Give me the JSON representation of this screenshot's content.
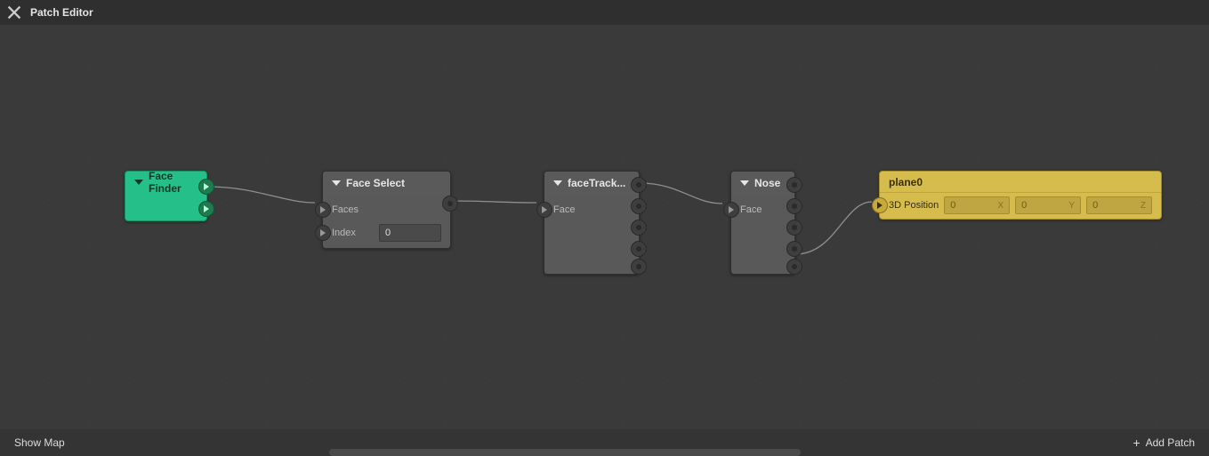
{
  "header": {
    "title": "Patch Editor"
  },
  "footer": {
    "show_map": "Show Map",
    "add_patch": "Add Patch"
  },
  "nodes": {
    "face_finder": {
      "title": "Face Finder"
    },
    "face_select": {
      "title": "Face Select",
      "input_faces": "Faces",
      "input_index": "Index",
      "index_value": "0"
    },
    "facetrack": {
      "title": "faceTrack...",
      "input_face": "Face"
    },
    "nose": {
      "title": "Nose",
      "input_face": "Face"
    },
    "plane0": {
      "title": "plane0",
      "pos_label": "3D Position",
      "x": "0",
      "y": "0",
      "z": "0",
      "ax": "X",
      "ay": "Y",
      "az": "Z"
    }
  }
}
